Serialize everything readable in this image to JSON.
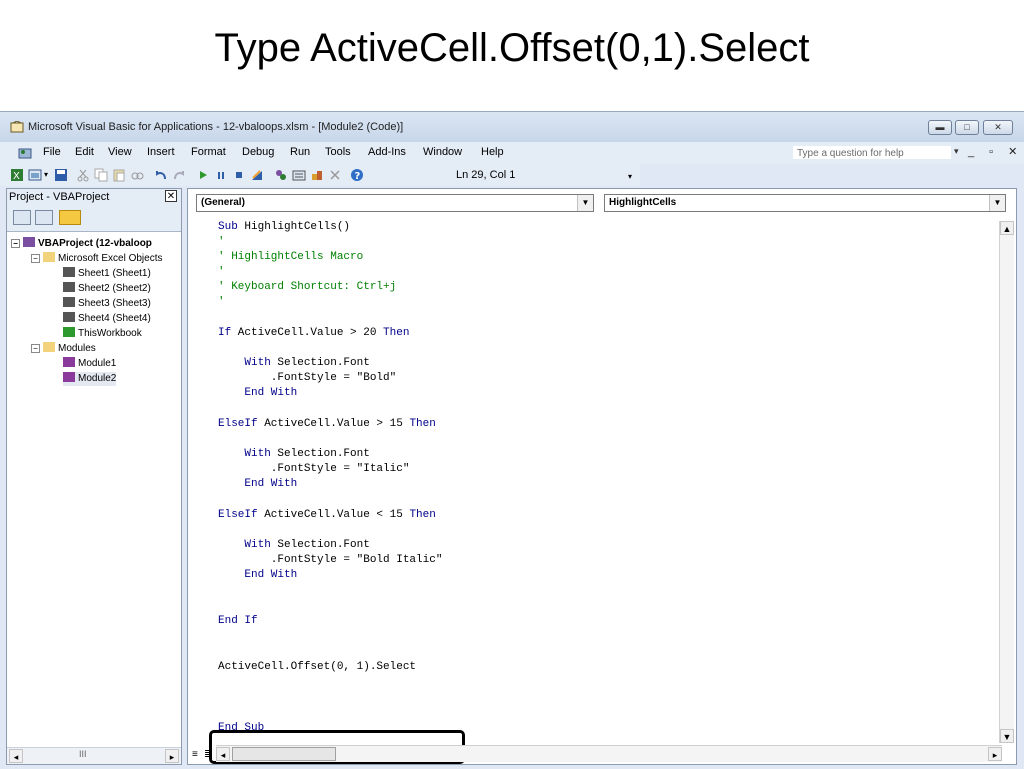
{
  "slide": {
    "title": "Type ActiveCell.Offset(0,1).Select"
  },
  "window": {
    "title": "Microsoft Visual Basic for Applications - 12-vbaloops.xlsm - [Module2 (Code)]"
  },
  "menu": {
    "items": [
      "File",
      "Edit",
      "View",
      "Insert",
      "Format",
      "Debug",
      "Run",
      "Tools",
      "Add-Ins",
      "Window",
      "Help"
    ],
    "help_placeholder": "Type a question for help"
  },
  "toolbar": {
    "position": "Ln 29, Col 1"
  },
  "project_panel": {
    "title": "Project - VBAProject",
    "tree": {
      "root": "VBAProject (12-vbaloop",
      "excel_objects": "Microsoft Excel Objects",
      "sheets": [
        "Sheet1 (Sheet1)",
        "Sheet2 (Sheet2)",
        "Sheet3 (Sheet3)",
        "Sheet4 (Sheet4)"
      ],
      "workbook": "ThisWorkbook",
      "modules_folder": "Modules",
      "modules": [
        "Module1",
        "Module2"
      ]
    }
  },
  "code_window": {
    "object_combo": "(General)",
    "procedure_combo": "HighlightCells",
    "lines": [
      "Sub HighlightCells()",
      "'",
      "' HighlightCells Macro",
      "'",
      "' Keyboard Shortcut: Ctrl+j",
      "'",
      "If ActiveCell.Value > 20 Then",
      "    With Selection.Font",
      "        .FontStyle = \"Bold\"",
      "    End With",
      "ElseIf ActiveCell.Value > 15 Then",
      "    With Selection.Font",
      "        .FontStyle = \"Italic\"",
      "    End With",
      "ElseIf ActiveCell.Value < 15 Then",
      "    With Selection.Font",
      "        .FontStyle = \"Bold Italic\"",
      "    End With",
      "End If",
      "ActiveCell.Offset(0, 1).Select",
      "End Sub"
    ]
  }
}
